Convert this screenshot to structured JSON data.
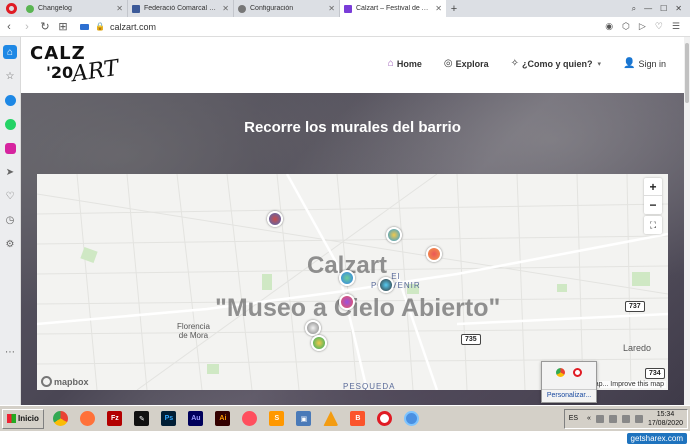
{
  "tabs": [
    {
      "title": "Changelog",
      "color": "#5ab552",
      "active": false
    },
    {
      "title": "Federació Comarcal CGT Bar",
      "color": "#3b5998",
      "active": false
    },
    {
      "title": "Configuración",
      "color": "#777777",
      "active": false
    },
    {
      "title": "Calzart – Festival de Arte Urb",
      "color": "#7a3dd8",
      "active": true
    }
  ],
  "address": {
    "url": "calzart.com"
  },
  "site": {
    "logo": {
      "calz": "CALZ",
      "year": "'20",
      "art": "ART"
    },
    "menu": {
      "home": "Home",
      "explore": "Explora",
      "how": "¿Como y quien?",
      "signin": "Sign in"
    }
  },
  "hero": {
    "title": "Recorre los murales del barrio"
  },
  "map": {
    "big_title": "Calzart",
    "big_subtitle": "\"Museo a Cielo Abierto\"",
    "labels": {
      "florencia": "Florencia\nde Mora",
      "porvenir": "El\nPORVENIR",
      "laredo": "Laredo",
      "pesqueda": "PESQUEDA"
    },
    "shields": [
      "737",
      "735",
      "734"
    ],
    "zoom_in": "+",
    "zoom_out": "−",
    "mapbox": "mapbox",
    "attribution": "© Map... Improve this map"
  },
  "popup": {
    "label": "Personalizar..."
  },
  "taskbar": {
    "start": "Inicio",
    "lang": "ES",
    "time": "15:34",
    "date": "17/08/2020"
  },
  "watermark": "getsharex.com",
  "colors": {
    "accent": "#9b59b6",
    "hero_dark": "#4a4654",
    "opera_red": "#e01b24"
  }
}
